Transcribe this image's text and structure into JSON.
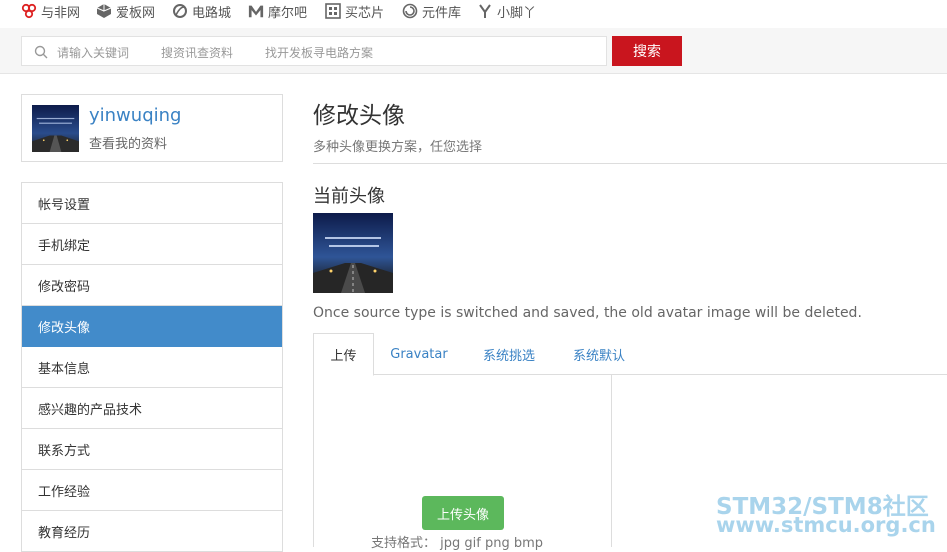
{
  "top_sites": [
    {
      "label": "与非网",
      "icon": "eefocus-icon"
    },
    {
      "label": "爱板网",
      "icon": "cube-icon"
    },
    {
      "label": "电路城",
      "icon": "leaf-icon"
    },
    {
      "label": "摩尔吧",
      "icon": "m-logo-icon"
    },
    {
      "label": "买芯片",
      "icon": "chip-grid-icon"
    },
    {
      "label": "元件库",
      "icon": "swirl-icon"
    },
    {
      "label": "小脚丫",
      "icon": "foot-icon"
    }
  ],
  "search": {
    "placeholder_1": "请输入关键词",
    "placeholder_2": "搜资讯查资料",
    "placeholder_3": "找开发板寻电路方案",
    "button": "搜索"
  },
  "profile": {
    "username": "yinwuqing",
    "view_profile": "查看我的资料"
  },
  "menu": [
    {
      "label": "帐号设置"
    },
    {
      "label": "手机绑定"
    },
    {
      "label": "修改密码"
    },
    {
      "label": "修改头像",
      "active": true
    },
    {
      "label": "基本信息"
    },
    {
      "label": "感兴趣的产品技术"
    },
    {
      "label": "联系方式"
    },
    {
      "label": "工作经验"
    },
    {
      "label": "教育经历"
    }
  ],
  "main": {
    "title": "修改头像",
    "subtitle": "多种头像更换方案，任您选择",
    "current_heading": "当前头像",
    "note": "Once source type is switched and saved, the old avatar image will be deleted.",
    "tabs": [
      "上传",
      "Gravatar",
      "系统挑选",
      "系统默认"
    ],
    "upload_button": "上传头像",
    "formats": "支持格式： jpg gif png bmp"
  },
  "watermark": {
    "line1": "STM32/STM8社区",
    "line2": "www.stmcu.org.cn"
  },
  "colors": {
    "accent_blue": "#428bca",
    "search_red": "#c9151e",
    "upload_green": "#5cb85c"
  }
}
